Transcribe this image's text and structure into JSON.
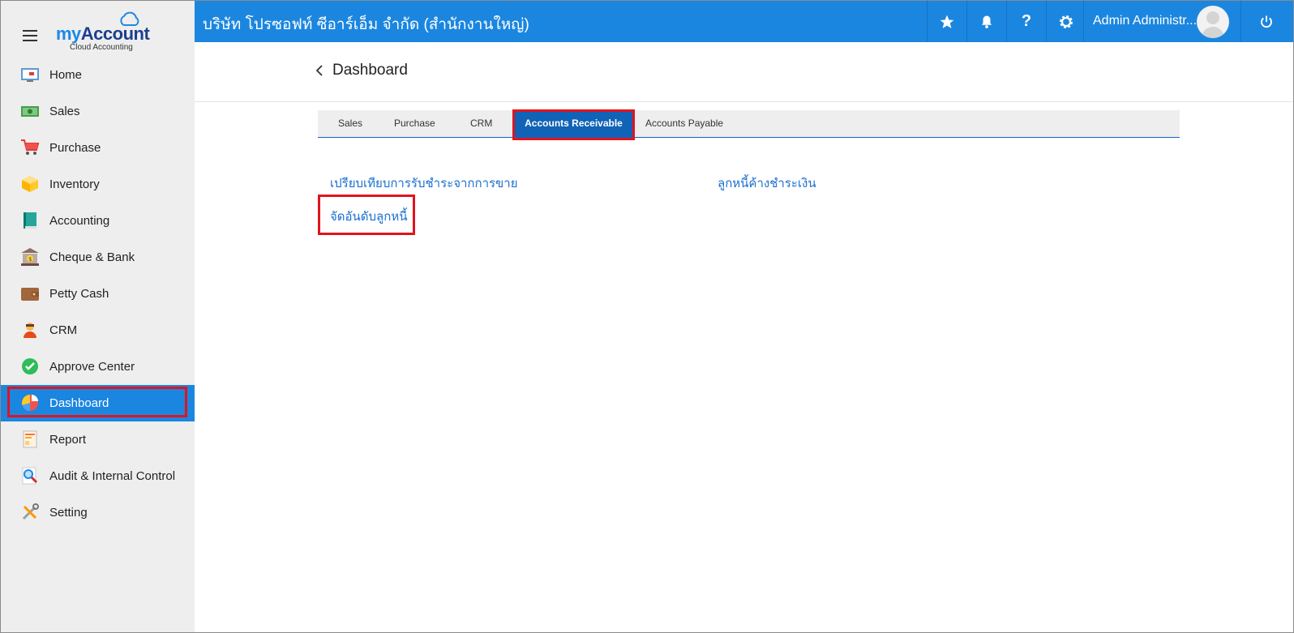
{
  "app": {
    "logo_brand_my": "my",
    "logo_brand_account": "Account",
    "logo_subtitle": "Cloud Accounting"
  },
  "sidebar": {
    "items": [
      {
        "label": "Home",
        "icon": "home-icon"
      },
      {
        "label": "Sales",
        "icon": "money-icon"
      },
      {
        "label": "Purchase",
        "icon": "cart-icon"
      },
      {
        "label": "Inventory",
        "icon": "box-icon"
      },
      {
        "label": "Accounting",
        "icon": "book-icon"
      },
      {
        "label": "Cheque & Bank",
        "icon": "bank-icon"
      },
      {
        "label": "Petty Cash",
        "icon": "wallet-icon"
      },
      {
        "label": "CRM",
        "icon": "people-icon"
      },
      {
        "label": "Approve Center",
        "icon": "check-circle-icon"
      },
      {
        "label": "Dashboard",
        "icon": "pie-chart-icon",
        "active": true
      },
      {
        "label": "Report",
        "icon": "report-icon"
      },
      {
        "label": "Audit & Internal Control",
        "icon": "magnifier-icon"
      },
      {
        "label": "Setting",
        "icon": "tools-icon"
      }
    ]
  },
  "topbar": {
    "company": "บริษัท โปรซอฟท์ ซีอาร์เอ็ม จำกัด (สำนักงานใหญ่)",
    "user_name": "Admin Administr...",
    "icons": [
      "star-icon",
      "bell-icon",
      "help-icon",
      "gear-icon",
      "power-icon"
    ]
  },
  "page": {
    "title": "Dashboard"
  },
  "tabs": [
    {
      "label": "Sales"
    },
    {
      "label": "Purchase"
    },
    {
      "label": "CRM"
    },
    {
      "label": "Accounts Receivable",
      "active": true
    },
    {
      "label": "Accounts Payable"
    }
  ],
  "links": {
    "compare_payment": "เปรียบเทียบการรับชำระจากการขาย",
    "outstanding_debtors": "ลูกหนี้ค้างชำระเงิน",
    "rank_debtors": "จัดอันดับลูกหนี้"
  },
  "colors": {
    "primary": "#1b86e0",
    "active_tab": "#1063b6",
    "highlight": "#e0141e",
    "link": "#1a6fd0"
  }
}
